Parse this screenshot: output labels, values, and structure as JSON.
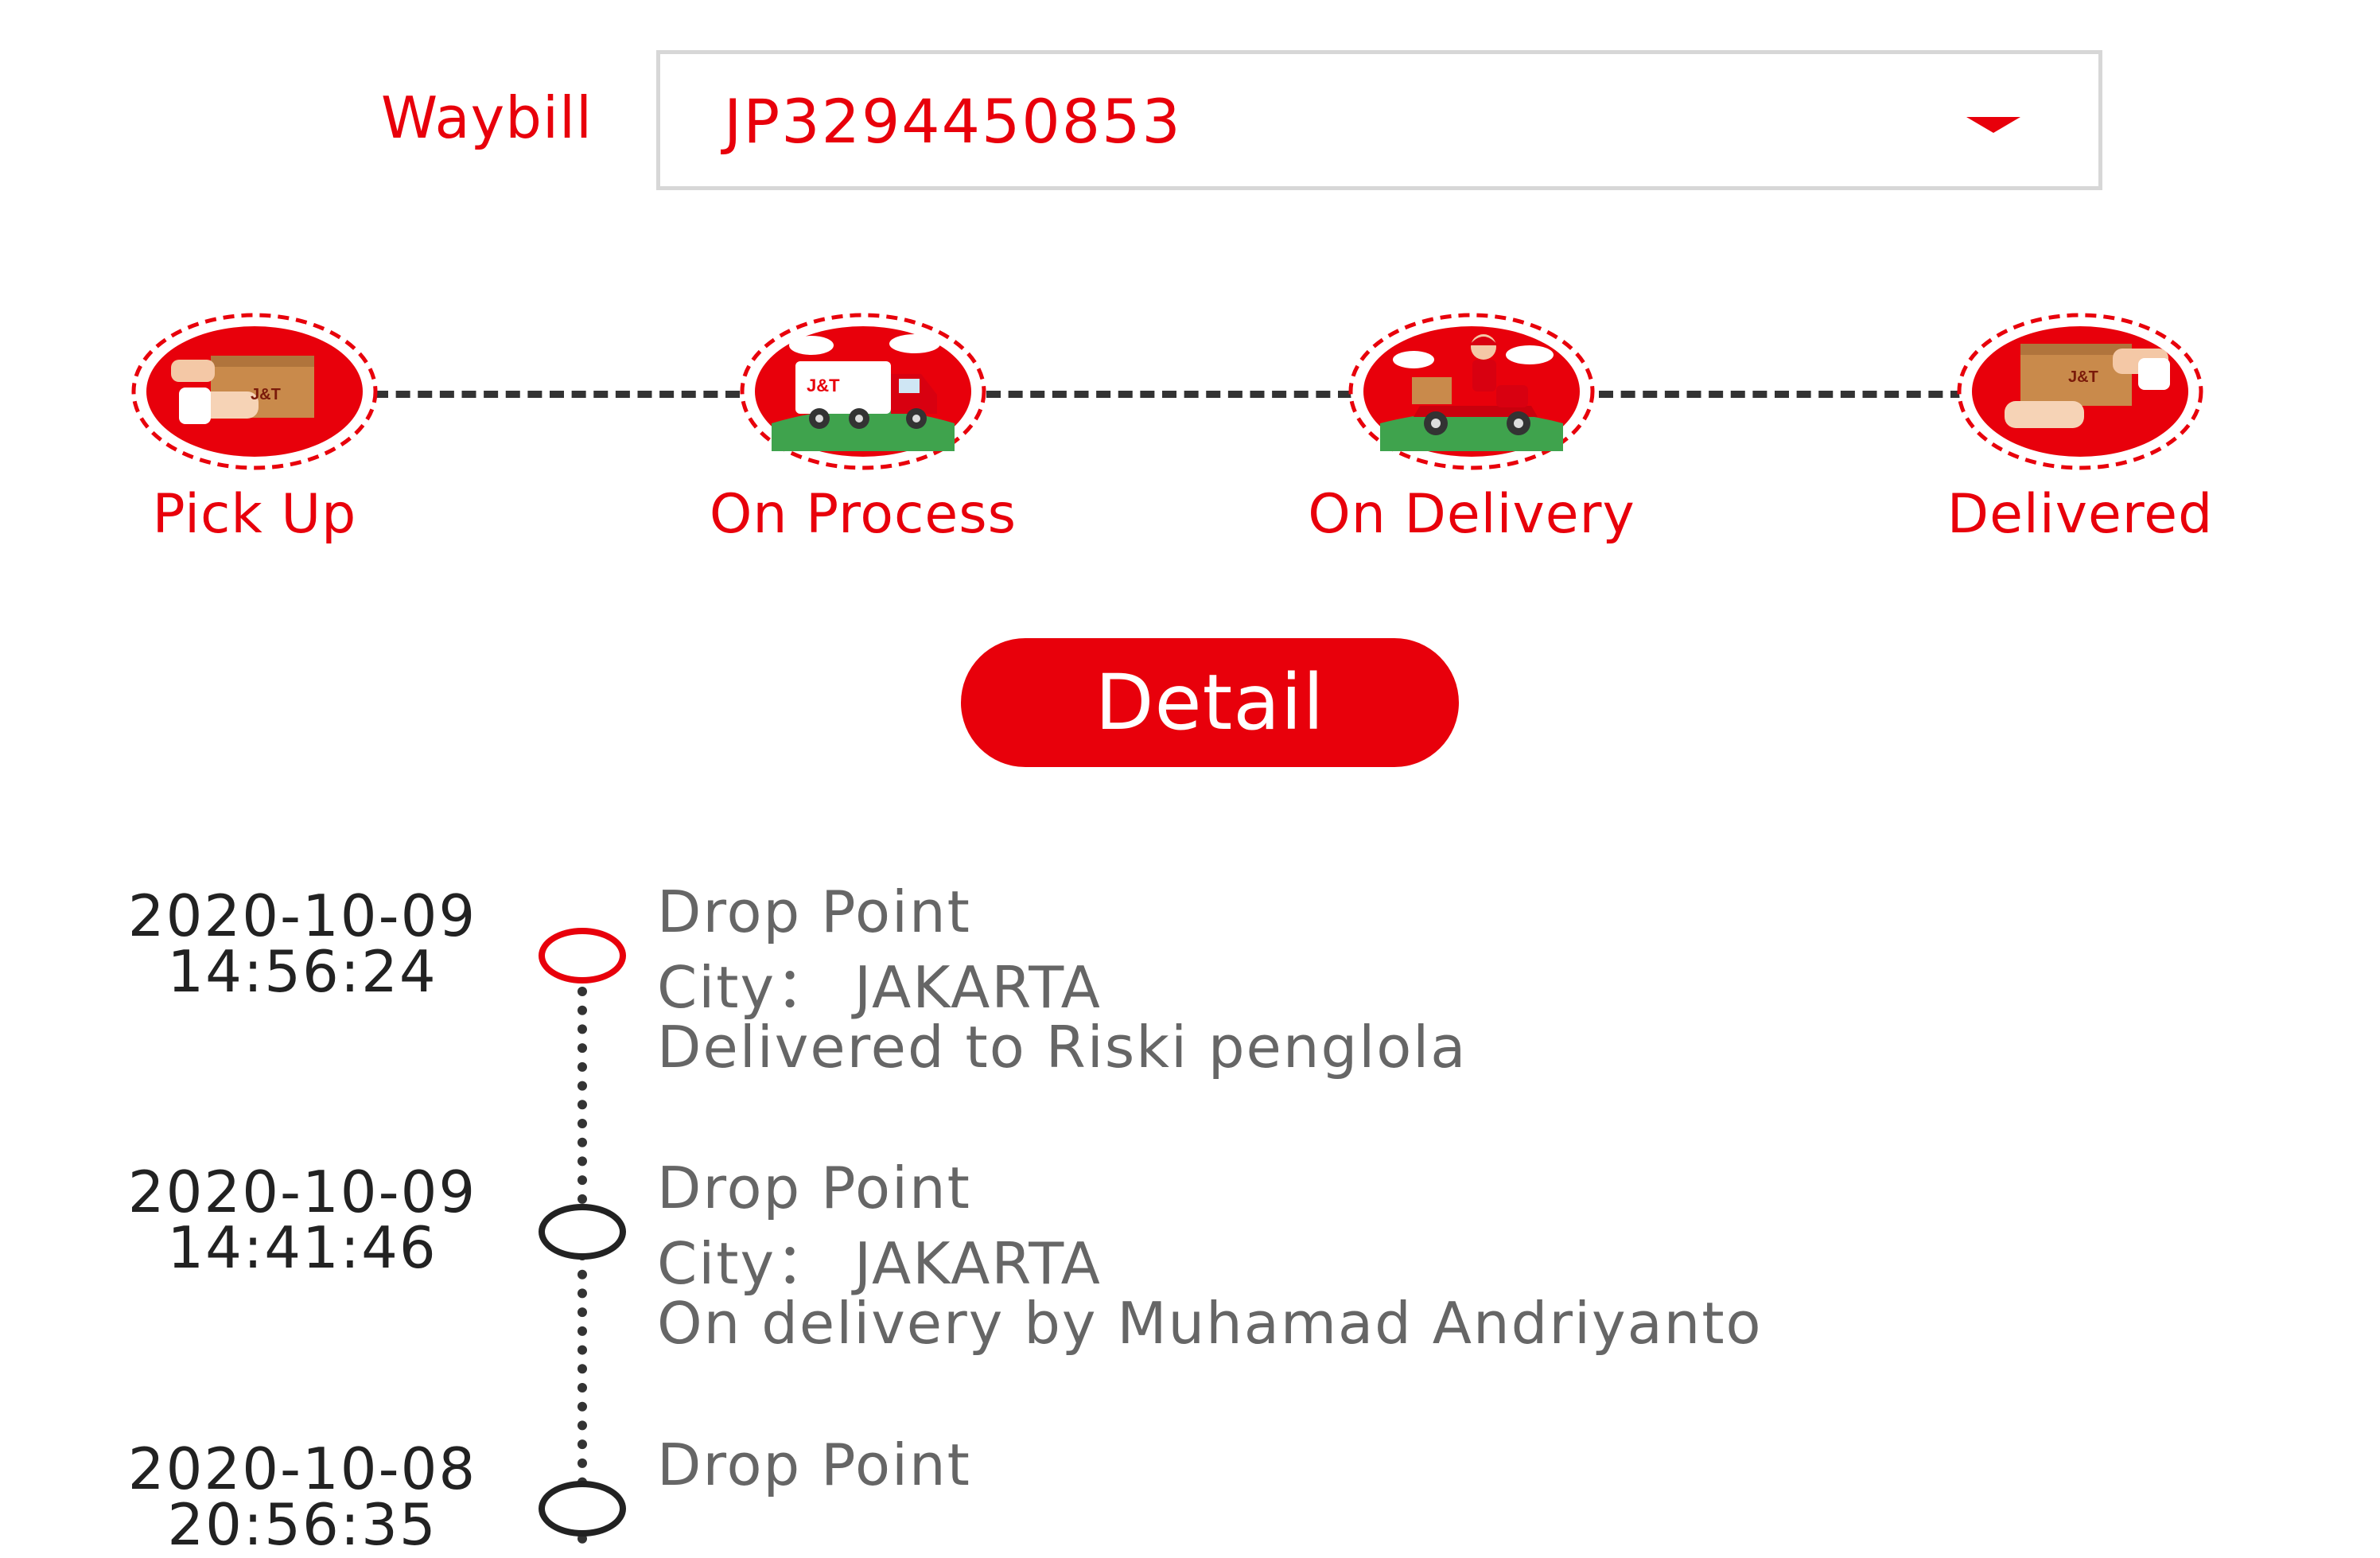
{
  "waybill": {
    "label": "Waybill",
    "value": "JP3294450853"
  },
  "steps": [
    {
      "label": "Pick Up",
      "icon": "pickup-package-icon"
    },
    {
      "label": "On Process",
      "icon": "delivery-truck-icon"
    },
    {
      "label": "On Delivery",
      "icon": "courier-scooter-icon"
    },
    {
      "label": "Delivered",
      "icon": "delivered-package-icon"
    }
  ],
  "detail_button": {
    "label": "Detail"
  },
  "events": [
    {
      "date": "2020-10-09",
      "time": "14:56:24",
      "title": "Drop Point",
      "city": "City： JAKARTA",
      "description": "Delivered to Riski penglola",
      "current": true
    },
    {
      "date": "2020-10-09",
      "time": "14:41:46",
      "title": "Drop Point",
      "city": "City： JAKARTA",
      "description": "On delivery by Muhamad Andriyanto",
      "current": false
    },
    {
      "date": "2020-10-08",
      "time": "20:56:35",
      "title": "Drop Point",
      "city": "",
      "description": "",
      "current": false
    }
  ],
  "colors": {
    "brand_red": "#e8000b",
    "text_dark": "#222222",
    "text_gray": "#666666",
    "border_gray": "#d7d7d7"
  }
}
